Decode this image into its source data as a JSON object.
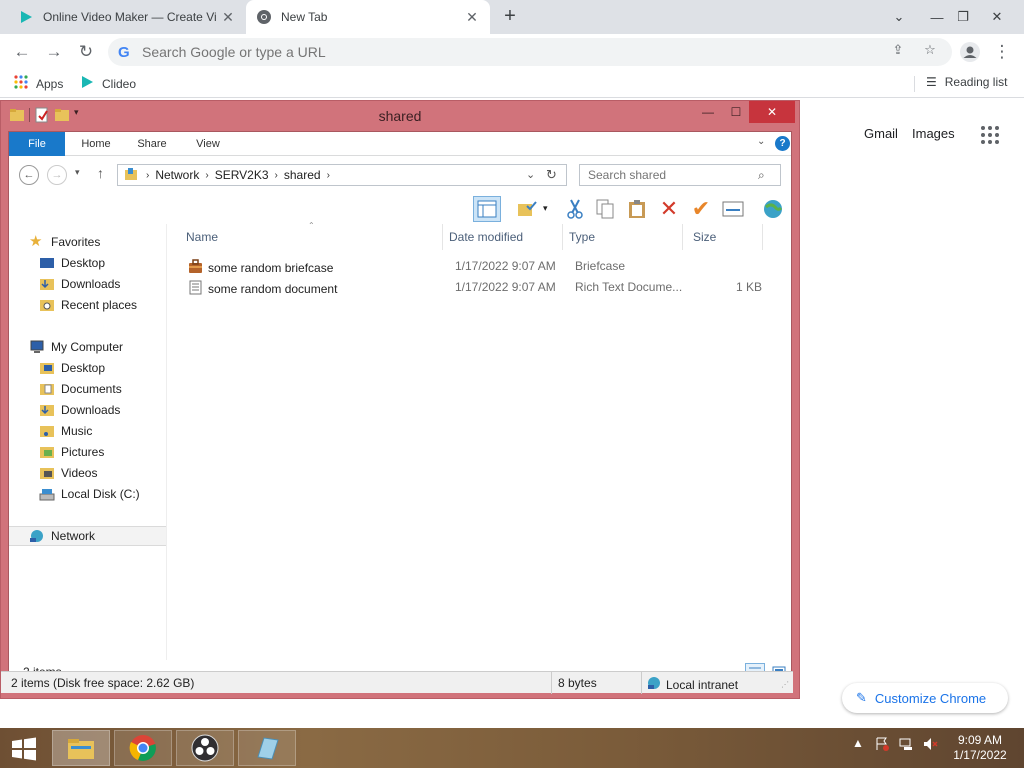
{
  "chrome": {
    "tabs": [
      {
        "title": "Online Video Maker — Create Vi",
        "favicon": "clideo-icon",
        "active": false
      },
      {
        "title": "New Tab",
        "favicon": "chrome-icon",
        "active": true
      }
    ],
    "new_tab_label": "+",
    "omnibox_placeholder": "Search Google or type a URL",
    "bookmarks": [
      {
        "label": "Apps",
        "icon": "apps-grid-icon"
      },
      {
        "label": "Clideo",
        "icon": "clideo-icon"
      }
    ],
    "reading_list": "Reading list",
    "ntp_links": {
      "gmail": "Gmail",
      "images": "Images"
    },
    "customize_label": "Customize Chrome",
    "colors": {
      "tab_strip": "#dee1e6",
      "accent": "#1a73e8"
    }
  },
  "explorer": {
    "title": "shared",
    "ribbon_tabs": [
      "File",
      "Home",
      "Share",
      "View"
    ],
    "breadcrumb": [
      "Network",
      "SERV2K3",
      "shared"
    ],
    "search_placeholder": "Search shared",
    "nav": {
      "favorites": {
        "label": "Favorites",
        "items": [
          "Desktop",
          "Downloads",
          "Recent places"
        ]
      },
      "computer": {
        "label": "My Computer",
        "items": [
          "Desktop",
          "Documents",
          "Downloads",
          "Music",
          "Pictures",
          "Videos",
          "Local Disk (C:)"
        ]
      },
      "network": "Network"
    },
    "columns": {
      "name": "Name",
      "date": "Date modified",
      "type": "Type",
      "size": "Size"
    },
    "files": [
      {
        "name": "some random briefcase",
        "date": "1/17/2022 9:07 AM",
        "type": "Briefcase",
        "size": "",
        "icon": "briefcase-icon"
      },
      {
        "name": "some random document",
        "date": "1/17/2022 9:07 AM",
        "type": "Rich Text Docume...",
        "size": "1 KB",
        "icon": "document-icon"
      }
    ],
    "item_count": "2 items",
    "status": {
      "summary": "2 items (Disk free space: 2.62 GB)",
      "size": "8 bytes",
      "zone": "Local intranet"
    },
    "colors": {
      "frame": "#d1737b",
      "file_tab": "#1979ca",
      "close": "#c7343d"
    }
  },
  "taskbar": {
    "apps": [
      "file-explorer-icon",
      "chrome-icon",
      "obs-icon",
      "notepad-icon"
    ],
    "time": "9:09 AM",
    "date": "1/17/2022"
  }
}
